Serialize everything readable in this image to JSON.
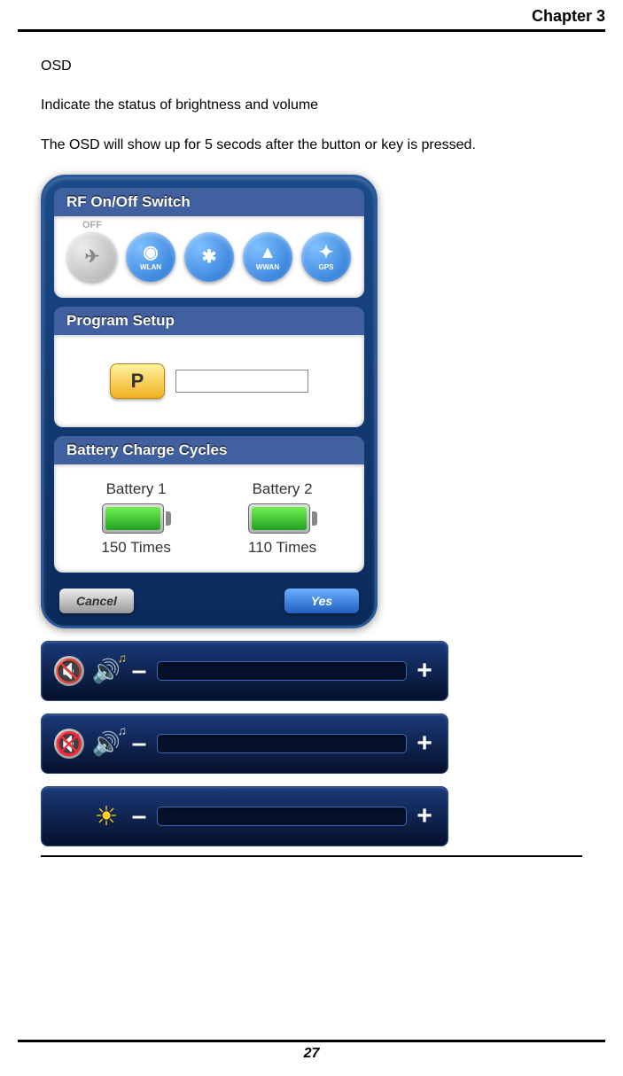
{
  "header": {
    "chapter": "Chapter 3"
  },
  "body": {
    "title": "OSD",
    "line1": "Indicate the status of brightness and volume",
    "line2": "The OSD will show up for 5 secods after the button or key is pressed."
  },
  "panel": {
    "rf": {
      "header": "RF On/Off Switch",
      "off_label": "OFF",
      "buttons": [
        {
          "name": "airplane",
          "label": "",
          "icon": "✈"
        },
        {
          "name": "wlan",
          "label": "WLAN",
          "icon": "◉"
        },
        {
          "name": "bluetooth",
          "label": "",
          "icon": "✱"
        },
        {
          "name": "wwan",
          "label": "WWAN",
          "icon": "▲"
        },
        {
          "name": "gps",
          "label": "GPS",
          "icon": "✦"
        }
      ]
    },
    "program": {
      "header": "Program Setup",
      "p_label": "P",
      "input_value": ""
    },
    "battery": {
      "header": "Battery Charge Cycles",
      "items": [
        {
          "label": "Battery 1",
          "count": "150  Times"
        },
        {
          "label": "Battery 2",
          "count": "110  Times"
        }
      ]
    },
    "footer": {
      "cancel": "Cancel",
      "yes": "Yes"
    }
  },
  "osd": {
    "minus": "–",
    "plus": "+"
  },
  "page_number": "27"
}
